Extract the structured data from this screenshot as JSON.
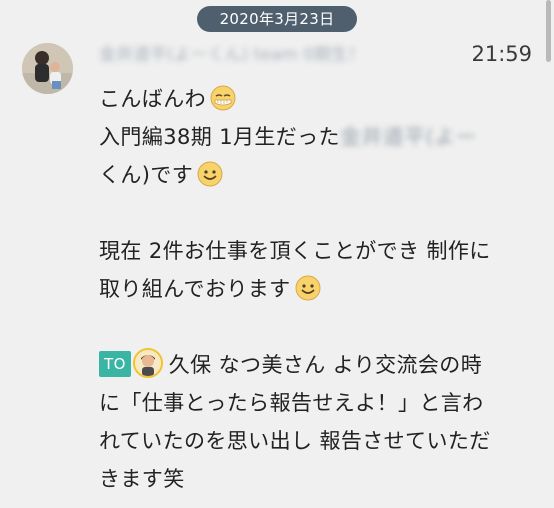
{
  "date_separator": "2020年3月23日",
  "message": {
    "sender_blurred": "金井道平(よーくん) team 0期生！",
    "time": "21:59",
    "lines": {
      "l1": "こんばんわ",
      "l2_a": "入門編38期 1月生だった",
      "l2_b_blurred": "金井道平(よー",
      "l3_a_blurred": "",
      "l3": "くん)です",
      "l5": "現在 2件お仕事を頂くことができ 制作に",
      "l6": "取り組んでおります",
      "to_tag": "TO",
      "l8": "久保 なつ美さん より交流会の時",
      "l9": "に「仕事とったら報告せえよ！」と言わ",
      "l10": "れていたのを思い出し 報告させていただ",
      "l11": "きます笑"
    }
  },
  "icons": {
    "sleep_emoji": "sleepy-face-icon",
    "smile_emoji": "smiling-face-icon"
  },
  "colors": {
    "background": "#f0f0f0",
    "date_pill": "#4f5f6e",
    "to_tag": "#3ab5a4"
  }
}
